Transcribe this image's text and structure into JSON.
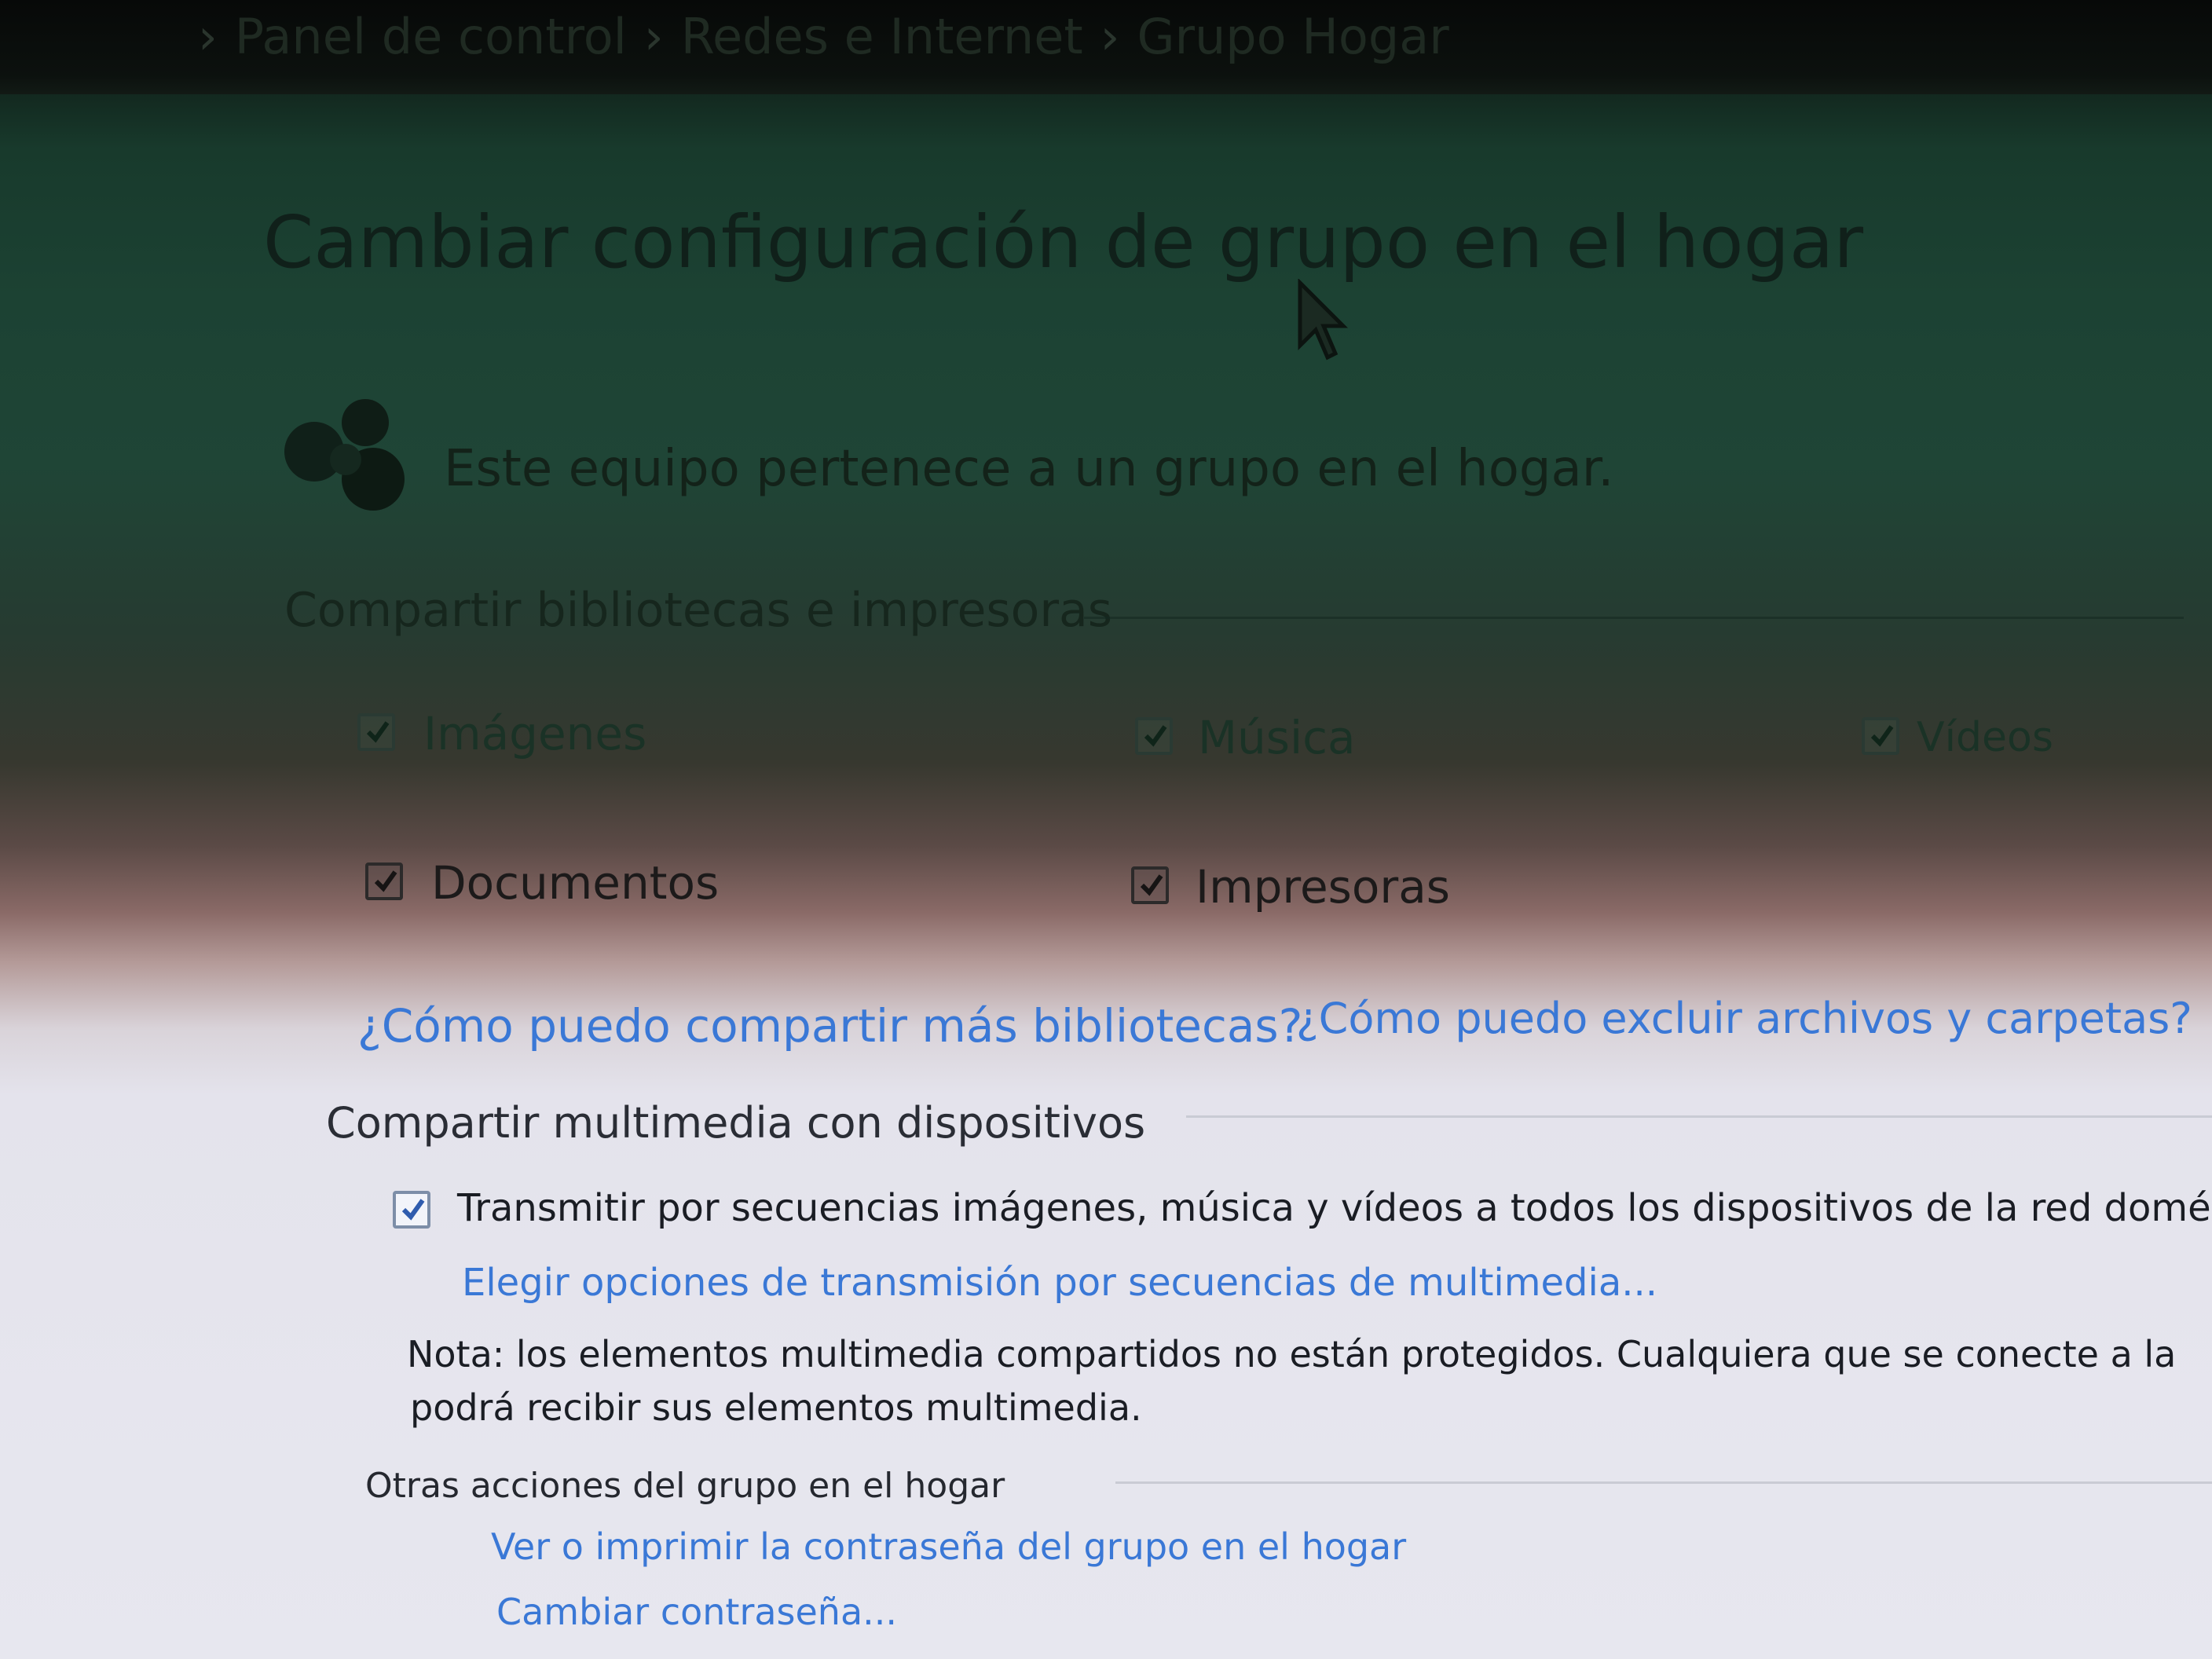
{
  "breadcrumb": {
    "items": [
      "Panel de control",
      "Redes e Internet",
      "Grupo Hogar"
    ]
  },
  "page_title": "Cambiar configuración de grupo en el hogar",
  "status_text": "Este equipo pertenece a un grupo en el hogar.",
  "share_libraries": {
    "heading": "Compartir bibliotecas e impresoras",
    "options": [
      {
        "label": "Imágenes",
        "checked": true
      },
      {
        "label": "Música",
        "checked": true
      },
      {
        "label": "Vídeos",
        "checked": true
      },
      {
        "label": "Documentos",
        "checked": true
      },
      {
        "label": "Impresoras",
        "checked": true
      }
    ],
    "link_more_libraries": "¿Cómo puedo compartir más bibliotecas?",
    "link_exclude": "¿Cómo puedo excluir archivos y carpetas?"
  },
  "media_sharing": {
    "heading": "Compartir multimedia con dispositivos",
    "stream_option": {
      "label": "Transmitir por secuencias imágenes, música y vídeos a todos los dispositivos de la red domé",
      "checked": true
    },
    "link_stream_options": "Elegir opciones de transmisión por secuencias de multimedia...",
    "note_line1": "Nota: los elementos multimedia compartidos no están protegidos. Cualquiera que se conecte a la",
    "note_line2": "podrá recibir sus elementos multimedia."
  },
  "other_actions": {
    "heading": "Otras acciones del grupo en el hogar",
    "link_view_password": "Ver o imprimir la contraseña del grupo en el hogar",
    "link_change_password": "Cambiar contraseña..."
  },
  "colors": {
    "link": "#3a78d6",
    "dark_band": "#1f4536",
    "light_band": "#e7e7ef"
  },
  "icons": {
    "checkbox": "checkmark-icon",
    "homegroup": "homegroup-icon",
    "cursor": "mouse-pointer-icon"
  }
}
